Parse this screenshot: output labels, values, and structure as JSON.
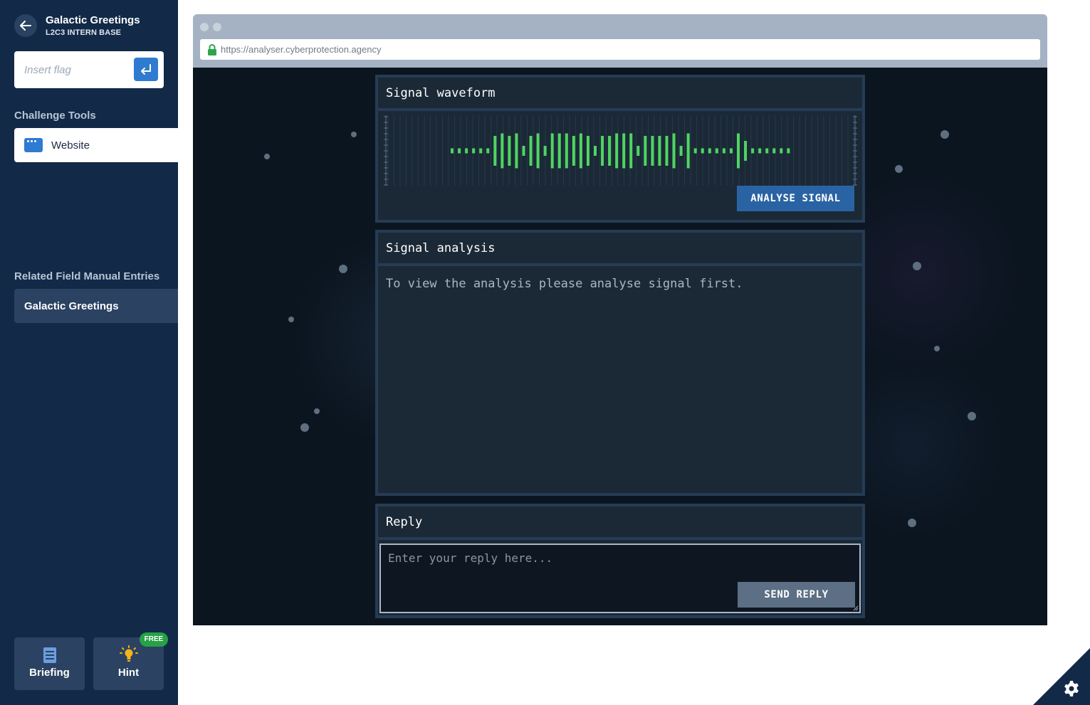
{
  "sidebar": {
    "title": "Galactic Greetings",
    "subtitle": "L2C3 INTERN BASE",
    "flag_placeholder": "Insert flag",
    "tools_heading": "Challenge Tools",
    "tools": [
      {
        "label": "Website",
        "icon": "browser-window-icon"
      }
    ],
    "manual_heading": "Related Field Manual Entries",
    "manual_items": [
      {
        "label": "Galactic Greetings"
      }
    ],
    "briefing_label": "Briefing",
    "hint_label": "Hint",
    "hint_badge": "FREE"
  },
  "browser": {
    "url": "https://analyser.cyberprotection.agency"
  },
  "page": {
    "waveform_title": "Signal waveform",
    "analyse_button": "ANALYSE SIGNAL",
    "analysis_title": "Signal analysis",
    "analysis_text": "To view the analysis please analyse signal first.",
    "reply_title": "Reply",
    "reply_placeholder": "Enter your reply here...",
    "send_button": "SEND REPLY"
  },
  "waveform": {
    "levels": [
      0.1,
      0.1,
      0.1,
      0.1,
      0.1,
      0.1,
      0.6,
      0.7,
      0.6,
      0.7,
      0.2,
      0.6,
      0.7,
      0.2,
      0.7,
      0.7,
      0.7,
      0.6,
      0.7,
      0.6,
      0.2,
      0.6,
      0.6,
      0.7,
      0.7,
      0.7,
      0.2,
      0.6,
      0.6,
      0.6,
      0.6,
      0.7,
      0.2,
      0.7,
      0.1,
      0.1,
      0.1,
      0.1,
      0.1,
      0.1,
      0.7,
      0.4,
      0.1,
      0.1,
      0.1,
      0.1,
      0.1,
      0.1
    ],
    "color": "#4fd561"
  },
  "colors": {
    "sidebar": "#122a48",
    "accent": "#2f7bd0",
    "hint_badge": "#27a146",
    "page_bg": "#0b1520"
  }
}
